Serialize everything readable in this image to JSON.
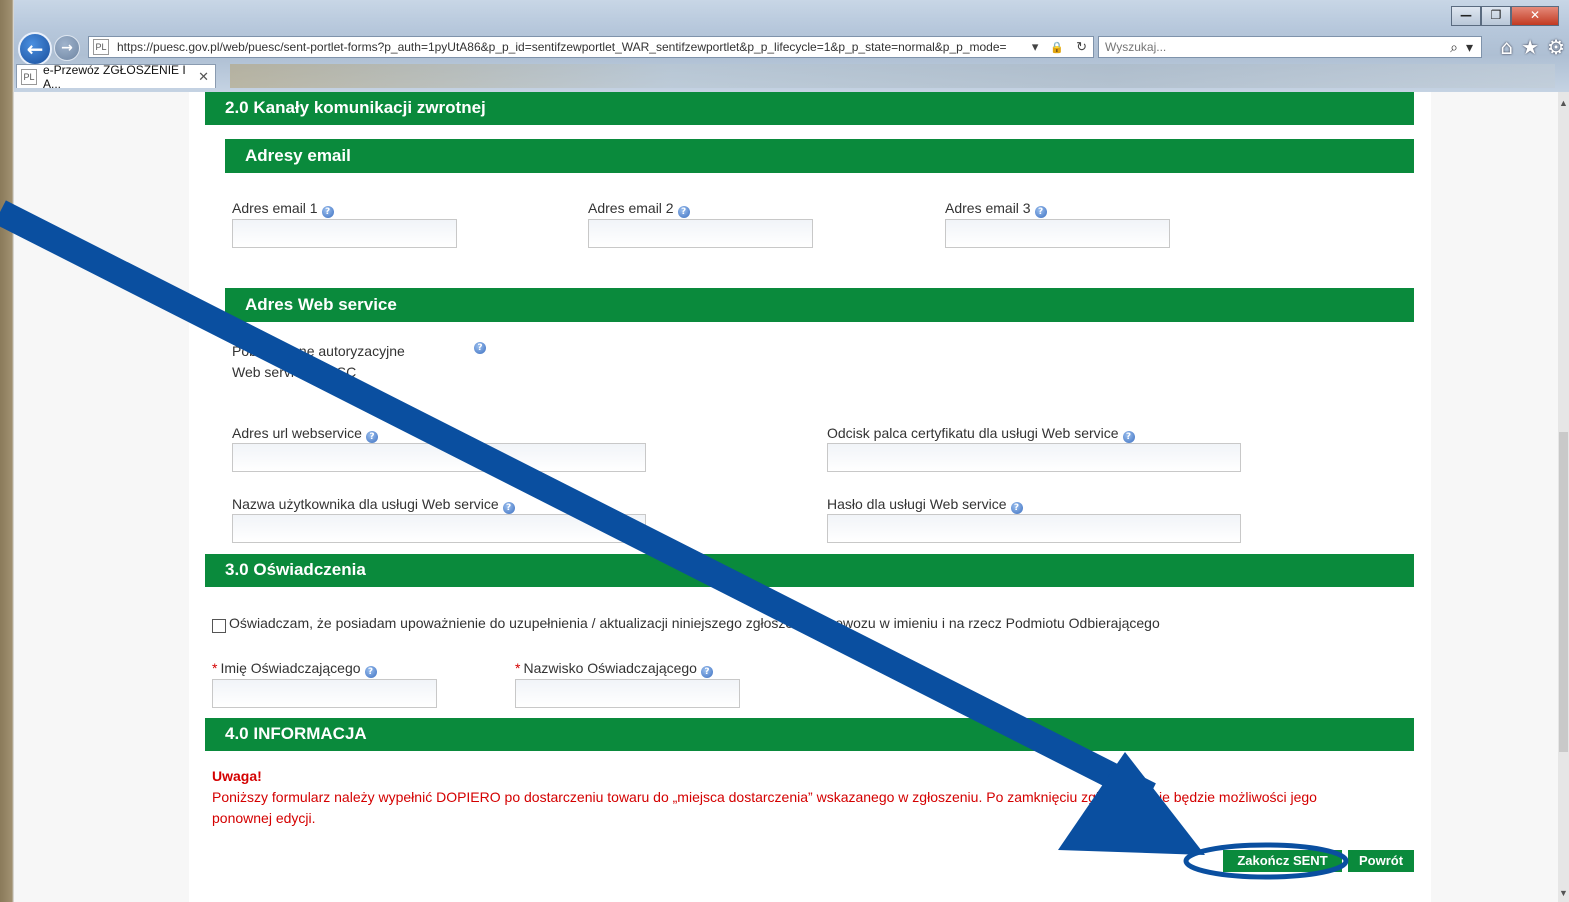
{
  "browser": {
    "url": "https://puesc.gov.pl/web/puesc/sent-portlet-forms?p_auth=1pyUtA86&p_p_id=sentifzewportlet_WAR_sentifzewportlet&p_p_lifecycle=1&p_p_state=normal&p_p_mode=",
    "search_placeholder": "Wyszukaj...",
    "tab_title": "e-Przewóz ZGŁOSZENIE I A...",
    "tab_close": "✕",
    "favicon": "pl-icon",
    "window_buttons": {
      "minimize": "—",
      "restore": "❐",
      "close": "✕"
    },
    "icons": {
      "back": "←",
      "forward": "→",
      "dropdown": "▾",
      "lock": "🔒",
      "refresh": "↻",
      "search": "⌕",
      "home": "⌂",
      "favorites": "★",
      "settings": "⚙"
    }
  },
  "sections": {
    "feedback": {
      "title": "2.0 Kanały komunikacji zwrotnej",
      "emails": {
        "title": "Adresy email",
        "fields": [
          {
            "label": "Adres email 1",
            "value": ""
          },
          {
            "label": "Adres email 2",
            "value": ""
          },
          {
            "label": "Adres email 3",
            "value": ""
          }
        ]
      },
      "webservice": {
        "title": "Adres Web service",
        "fetch_auth_label_line1": "Pobierz dane autoryzacyjne",
        "fetch_auth_label_line2": "Web service z SISC",
        "url_label": "Adres url webservice",
        "fingerprint_label": "Odcisk palca certyfikatu dla usługi Web service",
        "username_label": "Nazwa użytkownika dla usługi Web service",
        "password_label": "Hasło dla usługi Web service"
      }
    },
    "declarations": {
      "title": "3.0 Oświadczenia",
      "checkbox_label": "Oświadczam, że posiadam upoważnienie do uzupełnienia / aktualizacji niniejszego zgłoszenia przewozu w imieniu i na rzecz Podmiotu Odbierającego",
      "first_name_label": "Imię Oświadczającego",
      "last_name_label": "Nazwisko Oświadczającego",
      "required_mark": "*"
    },
    "info": {
      "title": "4.0 INFORMACJA",
      "warning_title": "Uwaga!",
      "warning_text_line1": "Poniższy formularz należy wypełnić DOPIERO po dostarczeniu towaru do „miejsca dostarczenia” wskazanego w zgłoszeniu. Po zamknięciu zgłoszenia nie będzie możliwości jego",
      "warning_text_line2": "ponownej edycji."
    }
  },
  "actions": {
    "finish_label": "Zakończ SENT",
    "back_label": "Powrót"
  },
  "help_glyph": "?",
  "colors": {
    "header_green": "#0a8a3c",
    "warning_red": "#d40000",
    "annotation_blue": "#0a4fa0"
  }
}
